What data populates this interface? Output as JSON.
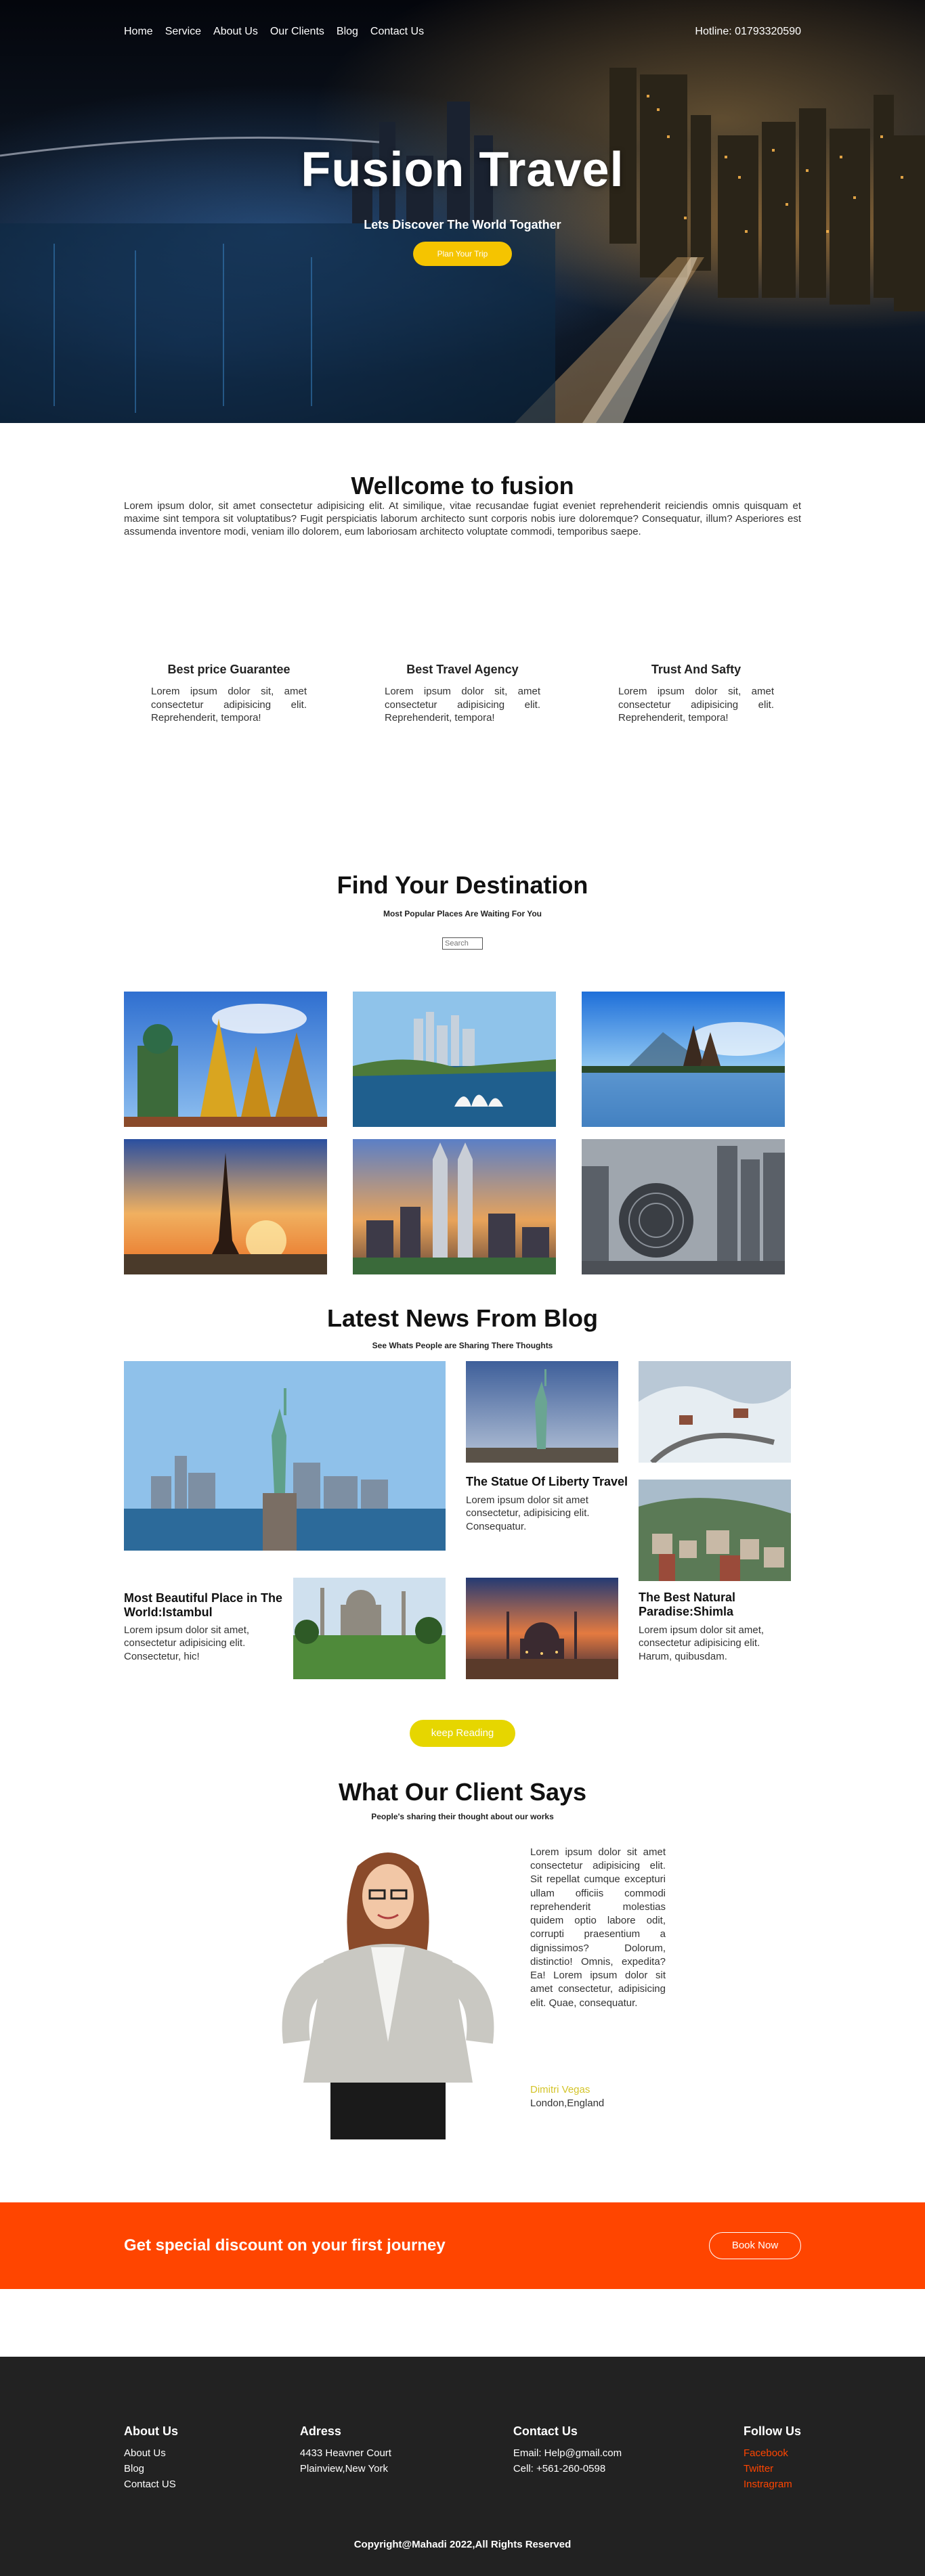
{
  "nav": {
    "items": [
      {
        "label": "Home"
      },
      {
        "label": "Service"
      },
      {
        "label": "About Us"
      },
      {
        "label": "Our Clients"
      },
      {
        "label": "Blog"
      },
      {
        "label": "Contact Us"
      }
    ],
    "hotline": "Hotline: 01793320590"
  },
  "hero": {
    "title": "Fusion Travel",
    "subtitle": "Lets Discover The World Togather",
    "button": "Plan Your Trip"
  },
  "welcome": {
    "title": "Wellcome to fusion",
    "text": "Lorem ipsum dolor, sit amet consectetur adipisicing elit. At similique, vitae recusandae fugiat eveniet reprehenderit reiciendis omnis quisquam et maxime sint tempora sit voluptatibus? Fugit perspiciatis laborum architecto sunt corporis nobis iure doloremque? Consequatur, illum? Asperiores est assumenda inventore modi, veniam illo dolorem, eum laboriosam architecto voluptate commodi, temporibus saepe."
  },
  "features": [
    {
      "title": "Best price Guarantee",
      "text": "Lorem ipsum dolor sit, amet consectetur adipisicing elit. Reprehenderit, tempora!"
    },
    {
      "title": "Best Travel Agency",
      "text": "Lorem ipsum dolor sit, amet consectetur adipisicing elit. Reprehenderit, tempora!"
    },
    {
      "title": "Trust And Safty",
      "text": "Lorem ipsum dolor sit, amet consectetur adipisicing elit. Reprehenderit, tempora!"
    }
  ],
  "destination": {
    "title": "Find Your Destination",
    "subtitle": "Most Popular Places Are Waiting For You",
    "search_placeholder": "Search"
  },
  "blog": {
    "title": "Latest News From Blog",
    "subtitle": "See Whats People are Sharing There Thoughts",
    "posts": [
      {
        "title": "The Statue Of Liberty Travel",
        "text": "Lorem ipsum dolor sit amet consectetur, adipisicing elit. Consequatur."
      },
      {
        "title": "Most Beautiful Place in The World:Istambul",
        "text": "Lorem ipsum dolor sit amet, consectetur adipisicing elit. Consectetur, hic!"
      },
      {
        "title": "The Best Natural Paradise:Shimla",
        "text": "Lorem ipsum dolor sit amet, consectetur adipisicing elit. Harum, quibusdam."
      }
    ],
    "keep_reading": "keep Reading"
  },
  "testimonial": {
    "title": "What Our Client Says",
    "subtitle": "People's sharing their thought about our works",
    "quote": "Lorem ipsum dolor sit amet consectetur adipisicing elit. Sit repellat cumque excepturi ullam officiis commodi reprehenderit molestias quidem optio labore odit, corrupti praesentium a dignissimos? Dolorum, distinctio! Omnis, expedita? Ea! Lorem ipsum dolor sit amet consectetur, adipisicing elit. Quae, consequatur.",
    "name": "Dimitri Vegas",
    "location": "London,England"
  },
  "discount": {
    "text": "Get special discount on your first journey",
    "button": "Book Now"
  },
  "footer": {
    "about": {
      "title": "About Us",
      "links": [
        "About Us",
        "Blog",
        "Contact US"
      ]
    },
    "address": {
      "title": "Adress",
      "lines": [
        "4433 Heavner Court",
        "Plainview,New York"
      ]
    },
    "contact": {
      "title": "Contact Us",
      "lines": [
        "Email: Help@gmail.com",
        "Cell: +561-260-0598"
      ]
    },
    "follow": {
      "title": "Follow Us",
      "links": [
        "Facebook",
        "Twitter",
        "Instragram"
      ]
    },
    "copyright": "Copyright@Mahadi 2022,All Rights Reserved"
  },
  "colors": {
    "accent_yellow": "#f5c400",
    "accent_orange": "#ff4500",
    "footer_bg": "#222222"
  }
}
